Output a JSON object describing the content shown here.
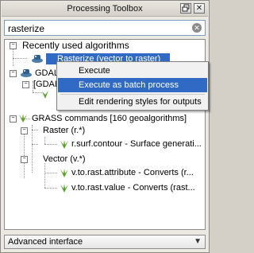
{
  "window": {
    "title": "Processing Toolbox"
  },
  "search": {
    "value": "rasterize"
  },
  "tree": {
    "recent": {
      "label": "Recently used algorithms",
      "expander": "−"
    },
    "recent_item": {
      "label": "Rasterize (vector to raster)"
    },
    "gdal": {
      "label": "GDAL",
      "expander": "−"
    },
    "gdal_child": {
      "label": "[GDAL",
      "expander": "−"
    },
    "grass": {
      "label": "GRASS commands [160 geoalgorithms]",
      "expander": "−"
    },
    "raster": {
      "label": "Raster (r.*)",
      "expander": "−"
    },
    "raster_item": {
      "label": "r.surf.contour - Surface generati..."
    },
    "vector": {
      "label": "Vector (v.*)",
      "expander": "−"
    },
    "vector_item1": {
      "label": "v.to.rast.attribute - Converts (r..."
    },
    "vector_item2": {
      "label": "v.to.rast.value - Converts (rast..."
    }
  },
  "context_menu": {
    "items": [
      {
        "label": "Execute"
      },
      {
        "label": "Execute as batch process",
        "highlighted": true
      },
      {
        "label": "Edit rendering styles for outputs"
      }
    ]
  },
  "footer": {
    "mode": "Advanced interface"
  },
  "colors": {
    "selection": "#316ac5",
    "grass_green": "#5aa02c"
  }
}
